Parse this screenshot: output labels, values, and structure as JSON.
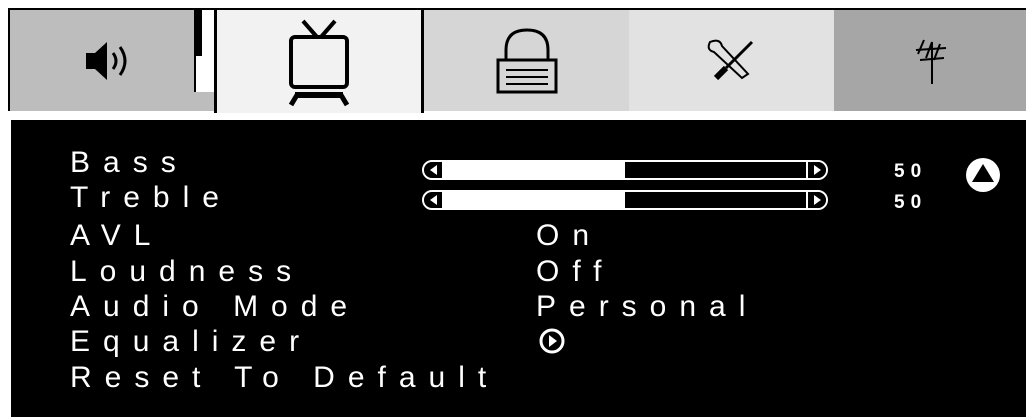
{
  "tabs": [
    {
      "id": "audio",
      "icon": "speaker-icon"
    },
    {
      "id": "picture",
      "icon": "tv-icon",
      "selected": true
    },
    {
      "id": "lock",
      "icon": "lock-icon"
    },
    {
      "id": "setup",
      "icon": "wrench-screwdriver-icon"
    },
    {
      "id": "channel",
      "icon": "antenna-icon"
    }
  ],
  "menu": {
    "bass": {
      "label": "Bass",
      "value": "50",
      "level": 50
    },
    "treble": {
      "label": "Treble",
      "value": "50",
      "level": 50
    },
    "avl": {
      "label": "AVL",
      "value": "On"
    },
    "loudness": {
      "label": "Loudness",
      "value": "Off"
    },
    "audio_mode": {
      "label": "Audio Mode",
      "value": "Personal"
    },
    "equalizer": {
      "label": "Equalizer",
      "icon": "play-circle-icon"
    },
    "reset": {
      "label": "Reset To Default"
    }
  },
  "scroll_up_icon": "up-arrow-circle-icon",
  "colors": {
    "panel": "#000000",
    "text": "#ffffff",
    "selected_tab": "#f2f2f2"
  }
}
